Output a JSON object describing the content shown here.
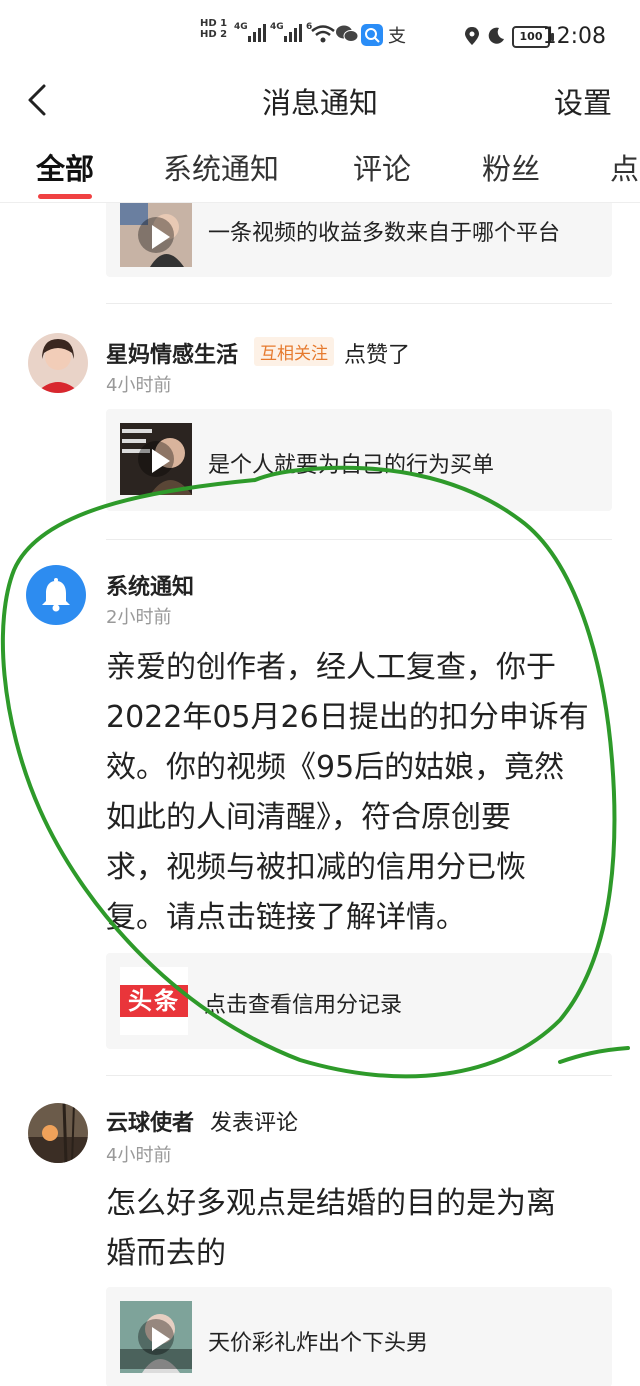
{
  "status_bar": {
    "hd1": "HD 1",
    "hd2": "HD 2",
    "net1": "4G",
    "net2": "4G",
    "wifi": "6",
    "battery": "100",
    "alipay": "支",
    "time": "12:08"
  },
  "header": {
    "title": "消息通知",
    "settings": "设置"
  },
  "tabs": [
    {
      "label": "全部",
      "active": true
    },
    {
      "label": "系统通知"
    },
    {
      "label": "评论"
    },
    {
      "label": "粉丝"
    },
    {
      "label": "点"
    }
  ],
  "items": [
    {
      "card_text": "一条视频的收益多数来自于哪个平台"
    },
    {
      "user": "星妈情感生活",
      "tag": "互相关注",
      "action": "点赞了",
      "time": "4小时前",
      "card_text": "是个人就要为自己的行为买单"
    },
    {
      "user": "系统通知",
      "time": "2小时前",
      "body_lines": [
        "亲爱的创作者，经人工复查，你于",
        "2022年05月26日提出的扣分申诉有",
        "效。你的视频《95后的姑娘，竟然",
        "如此的人间清醒》，符合原创要",
        "求，视频与被扣减的信用分已恢",
        "复。请点击链接了解详情。"
      ],
      "link_logo": "头条",
      "link_text": "点击查看信用分记录"
    },
    {
      "user": "云球使者",
      "action": "发表评论",
      "time": "4小时前",
      "body_lines": [
        "怎么好多观点是结婚的目的是为离",
        "婚而去的"
      ],
      "card_text": "天价彩礼炸出个下头男"
    }
  ],
  "colors": {
    "accent_red": "#f04142",
    "bell_blue": "#2d8cf0",
    "tag_orange": "#e67a2e",
    "annotation_green": "#2e9a2a"
  }
}
